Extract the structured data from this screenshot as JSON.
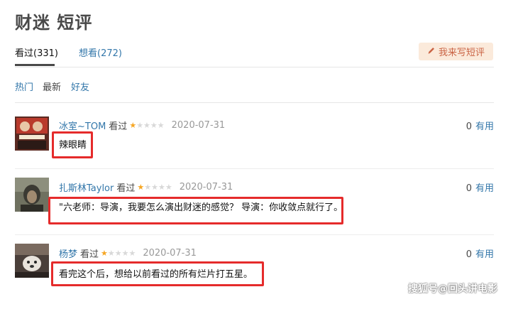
{
  "header": {
    "title": "财迷 短评"
  },
  "tabs": [
    {
      "label": "看过(331)",
      "active": true
    },
    {
      "label": "想看(272)",
      "active": false
    }
  ],
  "write_button": {
    "label": "我来写短评",
    "icon": "pencil-icon"
  },
  "filters": [
    "热门",
    "最新",
    "好友"
  ],
  "comments": [
    {
      "user": "冰室~TOM",
      "status": "看过",
      "rating": 1,
      "date": "2020-07-31",
      "votes": "0",
      "vote_label": "有用",
      "text": "辣眼睛"
    },
    {
      "user": "扎斯林Taylor",
      "status": "看过",
      "rating": 1,
      "date": "2020-07-31",
      "votes": "0",
      "vote_label": "有用",
      "text": "\"六老师：导演，我要怎么演出财迷的感觉？ 导演：你收敛点就行了。"
    },
    {
      "user": "杨梦",
      "status": "看过",
      "rating": 1,
      "date": "2020-07-31",
      "votes": "0",
      "vote_label": "有用",
      "text": "看完这个后，想给以前看过的所有烂片打五星。"
    }
  ],
  "watermark": "搜狐号@回头讲电影",
  "colors": {
    "link": "#3377aa",
    "star": "#f6a623",
    "highlight": "#e52b2b",
    "button_bg": "#fbeadb",
    "button_text": "#ca6445"
  }
}
